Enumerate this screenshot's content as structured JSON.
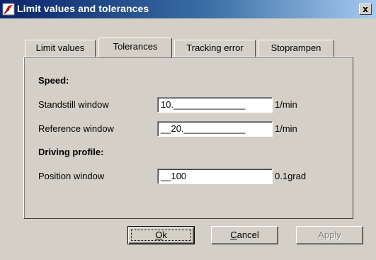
{
  "window": {
    "title": "Limit values and tolerances",
    "close_glyph": "x"
  },
  "tabs": [
    {
      "label": "Limit values",
      "active": false
    },
    {
      "label": "Tolerances",
      "active": true
    },
    {
      "label": "Tracking error",
      "active": false
    },
    {
      "label": "Stoprampen",
      "active": false
    }
  ],
  "sections": {
    "speed": "Speed:",
    "driving_profile": "Driving profile:"
  },
  "fields": [
    {
      "label": "Standstill window",
      "value": "10.______________",
      "unit": "1/min"
    },
    {
      "label": "Reference window",
      "value": "__20.____________",
      "unit": "1/min"
    },
    {
      "label": "Position window",
      "value": "__100",
      "unit": "0.1grad"
    }
  ],
  "buttons": {
    "ok": {
      "accel": "O",
      "rest": "k"
    },
    "cancel": {
      "accel": "C",
      "rest": "ancel"
    },
    "apply": {
      "accel": "A",
      "rest": "pply"
    }
  },
  "colors": {
    "titlebar_start": "#0a246a",
    "titlebar_end": "#a6caf0",
    "face": "#d4d0c8"
  },
  "icons": {
    "title": "app-icon"
  }
}
